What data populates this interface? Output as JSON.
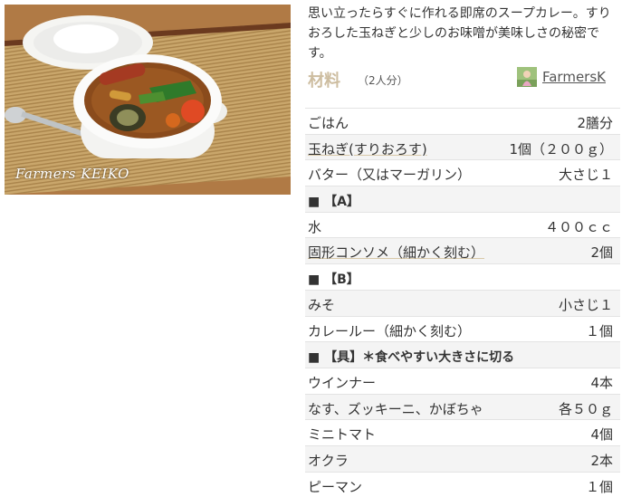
{
  "photo": {
    "watermark": "Farmers KEIKO"
  },
  "recipe": {
    "description": "思い立ったらすぐに作れる即席のスープカレー。すりおろした玉ねぎと少しのお味噌が美味しさの秘密です。",
    "ingredients_title": "材料",
    "servings": "（2人分）",
    "author": "FarmersK",
    "ingredients": [
      {
        "name": "ごはん",
        "qty": "2膳分",
        "type": "item"
      },
      {
        "name": "玉ねぎ(すりおろす)",
        "qty": "1個（２００ｇ）",
        "type": "item",
        "link": true
      },
      {
        "name": "バター（又はマーガリン）",
        "qty": "大さじ１",
        "type": "item"
      },
      {
        "name": "■ 【A】",
        "qty": "",
        "type": "heading"
      },
      {
        "name": "水",
        "qty": "４００ｃｃ",
        "type": "item"
      },
      {
        "name": "固形コンソメ（細かく刻む）",
        "qty": "2個",
        "type": "item",
        "link": true
      },
      {
        "name": "■ 【B】",
        "qty": "",
        "type": "heading"
      },
      {
        "name": "みそ",
        "qty": "小さじ１",
        "type": "item"
      },
      {
        "name": "カレールー（細かく刻む）",
        "qty": "１個",
        "type": "item"
      },
      {
        "name": "■ 【具】＊食べやすい大きさに切る",
        "qty": "",
        "type": "heading"
      },
      {
        "name": "ウインナー",
        "qty": "4本",
        "type": "item"
      },
      {
        "name": "なす、ズッキーニ、かぼちゃ",
        "qty": "各５０ｇ",
        "type": "item"
      },
      {
        "name": "ミニトマト",
        "qty": "4個",
        "type": "item"
      },
      {
        "name": "オクラ",
        "qty": "2本",
        "type": "item"
      },
      {
        "name": "ピーマン",
        "qty": "１個",
        "type": "item"
      }
    ]
  }
}
